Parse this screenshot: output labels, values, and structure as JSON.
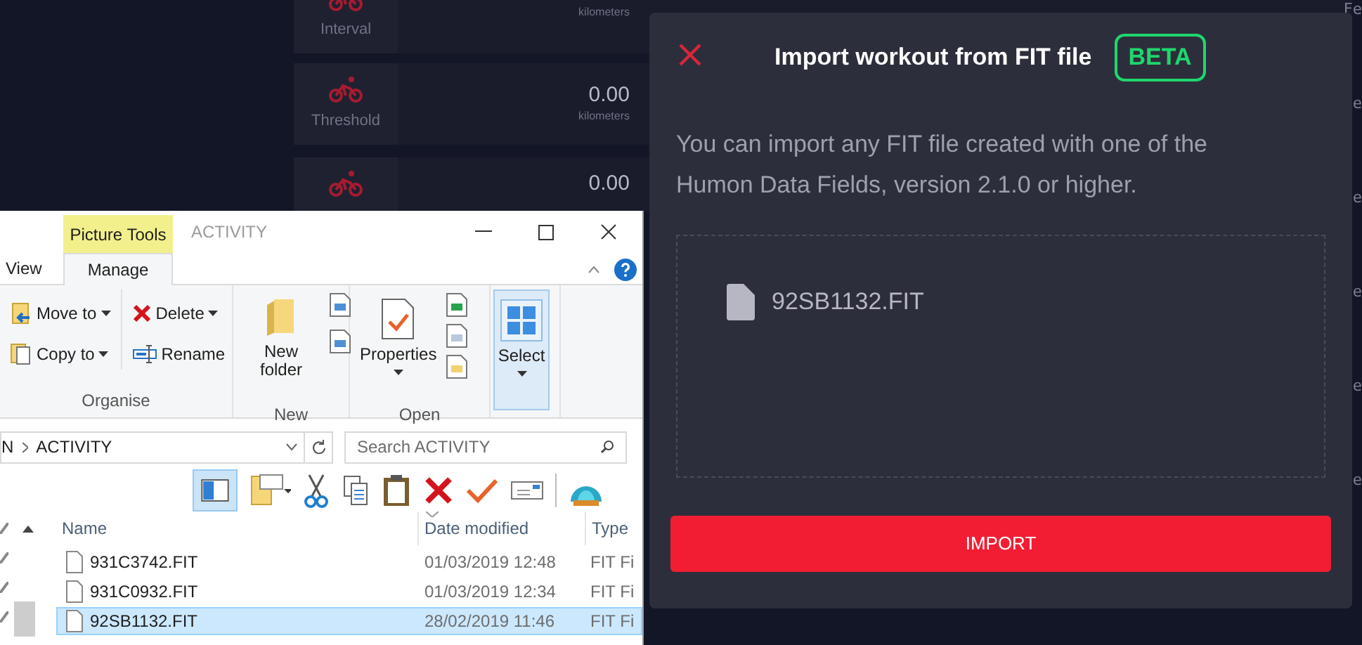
{
  "app": {
    "cards": [
      {
        "label": "Interval",
        "unit": "kilometers"
      },
      {
        "label": "Threshold",
        "value": "0.00",
        "unit": "kilometers"
      },
      {
        "value": "0.00"
      }
    ],
    "edge_texts": [
      "Fe",
      "e",
      "e",
      "e",
      "e",
      "e"
    ]
  },
  "explorer": {
    "title_tabs": [
      {
        "label": "Picture Tools",
        "kind": "context"
      },
      {
        "label": "ACTIVITY",
        "kind": "title"
      }
    ],
    "ribbon_tabs": [
      {
        "label": "View",
        "selected": false
      },
      {
        "label": "Manage",
        "selected": true
      }
    ],
    "groups": [
      {
        "label": "Organise",
        "buttons": [
          {
            "label": "Move to",
            "kind": "move"
          },
          {
            "label": "Copy to",
            "kind": "copy"
          },
          {
            "label": "Delete",
            "kind": "delete"
          },
          {
            "label": "Rename",
            "kind": "rename"
          }
        ]
      },
      {
        "label": "New",
        "buttons": [
          {
            "label": "New folder",
            "kind": "folder"
          }
        ]
      },
      {
        "label": "Open",
        "buttons": [
          {
            "label": "Properties",
            "kind": "properties"
          }
        ]
      },
      {
        "buttons": [
          {
            "label": "Select",
            "kind": "select"
          }
        ]
      }
    ],
    "address": [
      "N",
      "ACTIVITY"
    ],
    "search": {
      "placeholder": "Search ACTIVITY"
    },
    "columns": [
      "Name",
      "Date modified",
      "Type"
    ],
    "rows": [
      {
        "name": "931C3742.FIT",
        "date": "01/03/2019 12:48",
        "type": "FIT Fi",
        "selected": false
      },
      {
        "name": "931C0932.FIT",
        "date": "01/03/2019 12:34",
        "type": "FIT Fi",
        "selected": false
      },
      {
        "name": "92SB1132.FIT",
        "date": "28/02/2019 11:46",
        "type": "FIT Fi",
        "selected": true
      }
    ]
  },
  "dialog": {
    "title": "Import workout from FIT file",
    "badge": "BETA",
    "description": "You can import any FIT file created with one of the Humon Data Fields, version 2.1.0 or higher.",
    "file": "92SB1132.FIT",
    "button": "IMPORT"
  }
}
